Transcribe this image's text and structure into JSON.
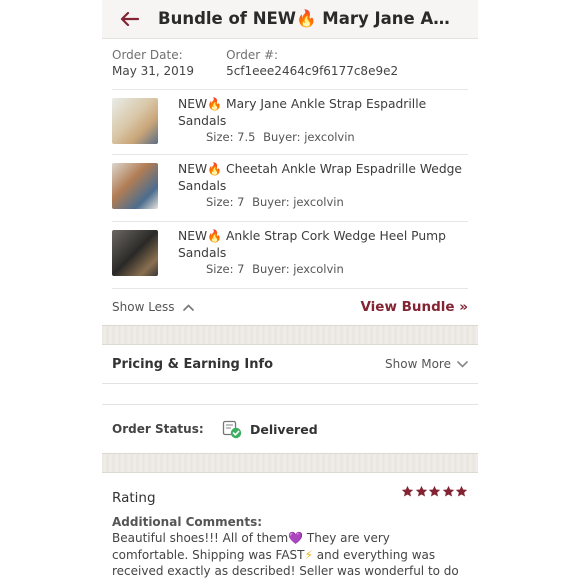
{
  "header": {
    "title": "Bundle of NEW🔥 Mary Jane Ankle Strap Espadrille Sandals",
    "back_icon": "arrow-left-icon"
  },
  "order": {
    "date_label": "Order Date:",
    "date_value": "May 31, 2019",
    "number_label": "Order #:",
    "number_value": "5cf1eee2464c9f6177c8e9e2"
  },
  "items": [
    {
      "title": "Mary Jane Ankle Strap Espadrille Sandals",
      "size": "Size: 7.5",
      "buyer": "Buyer: jexcolvin"
    },
    {
      "title": "Cheetah Ankle Wrap Espadrille Wedge Sandals",
      "size": "Size: 7",
      "buyer": "Buyer: jexcolvin"
    },
    {
      "title": "Ankle Strap Cork Wedge Heel Pump Sandals",
      "size": "Size: 7",
      "buyer": "Buyer: jexcolvin"
    }
  ],
  "new_prefix": "NEW",
  "fire_emoji": "🔥",
  "bundle": {
    "show_less": "Show Less",
    "view_bundle": "View Bundle »"
  },
  "pricing": {
    "title": "Pricing & Earning Info",
    "show_more": "Show More"
  },
  "status": {
    "label": "Order Status:",
    "value": "Delivered"
  },
  "rating": {
    "label": "Rating",
    "stars": 5,
    "comments_label": "Additional Comments:",
    "comments_part1": "Beautiful shoes!!! All of them",
    "heart": "💜",
    "comments_part2": " They are very comfortable. Shipping was FAST",
    "bolt": "⚡",
    "comments_part3": " and everything was received exactly as described! Seller was wonderful to do business with!"
  },
  "colors": {
    "accent": "#822433",
    "status_green": "#3cae5f"
  }
}
